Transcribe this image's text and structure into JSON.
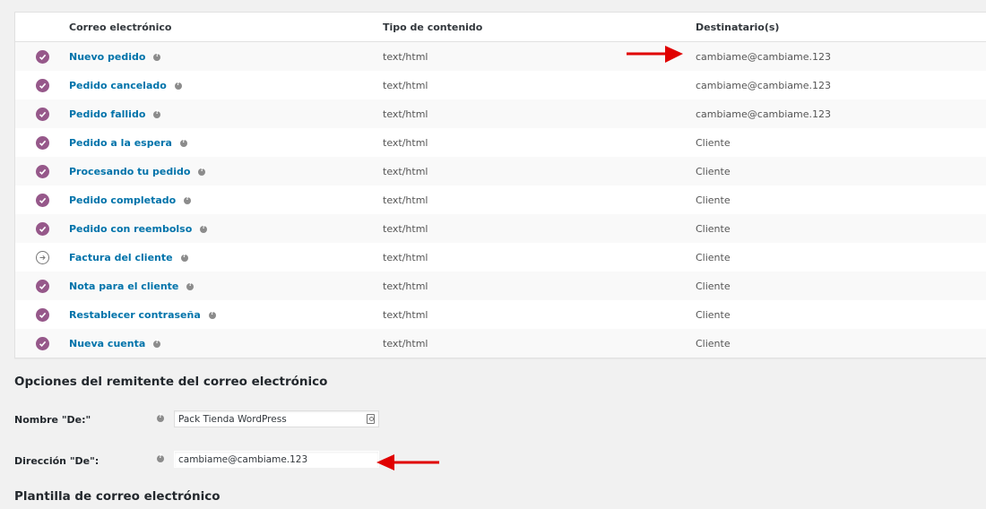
{
  "table": {
    "headers": {
      "email": "Correo electrónico",
      "content_type": "Tipo de contenido",
      "recipients": "Destinatario(s)"
    },
    "rows": [
      {
        "name": "Nuevo pedido",
        "type": "text/html",
        "recipient": "cambiame@cambiame.123",
        "enabled": true
      },
      {
        "name": "Pedido cancelado",
        "type": "text/html",
        "recipient": "cambiame@cambiame.123",
        "enabled": true
      },
      {
        "name": "Pedido fallido",
        "type": "text/html",
        "recipient": "cambiame@cambiame.123",
        "enabled": true
      },
      {
        "name": "Pedido a la espera",
        "type": "text/html",
        "recipient": "Cliente",
        "enabled": true
      },
      {
        "name": "Procesando tu pedido",
        "type": "text/html",
        "recipient": "Cliente",
        "enabled": true
      },
      {
        "name": "Pedido completado",
        "type": "text/html",
        "recipient": "Cliente",
        "enabled": true
      },
      {
        "name": "Pedido con reembolso",
        "type": "text/html",
        "recipient": "Cliente",
        "enabled": true
      },
      {
        "name": "Factura del cliente",
        "type": "text/html",
        "recipient": "Cliente",
        "enabled": false
      },
      {
        "name": "Nota para el cliente",
        "type": "text/html",
        "recipient": "Cliente",
        "enabled": true
      },
      {
        "name": "Restablecer contraseña",
        "type": "text/html",
        "recipient": "Cliente",
        "enabled": true
      },
      {
        "name": "Nueva cuenta",
        "type": "text/html",
        "recipient": "Cliente",
        "enabled": true
      }
    ]
  },
  "sender_options": {
    "title": "Opciones del remitente del correo electrónico",
    "from_name_label": "Nombre \"De:\"",
    "from_name_value": "Pack Tienda WordPress",
    "from_address_label": "Dirección \"De\":",
    "from_address_value": "cambiame@cambiame.123"
  },
  "template_section": {
    "title": "Plantilla de correo electrónico"
  },
  "icons": {
    "enabled": "check-circle-icon",
    "manual": "arrow-right-circle-icon",
    "help": "help-tip-icon",
    "annotation": "red-arrow-annotation"
  },
  "colors": {
    "accent": "#96588a",
    "link": "#0073aa",
    "annotation": "#e00000"
  }
}
